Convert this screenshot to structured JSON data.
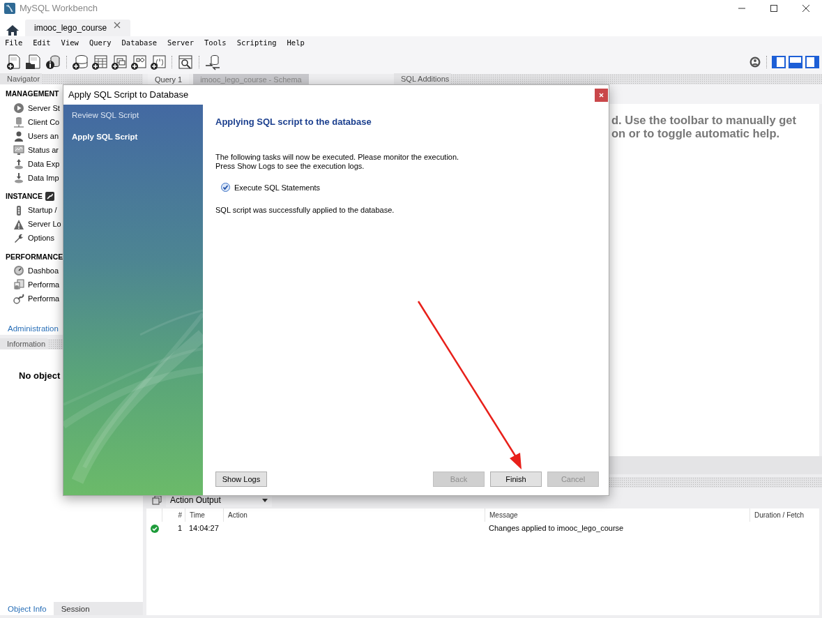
{
  "window": {
    "title": "MySQL Workbench"
  },
  "connection_tabs": [
    {
      "label": "imooc_lego_course",
      "selected": true
    }
  ],
  "menu": [
    "File",
    "Edit",
    "View",
    "Query",
    "Database",
    "Server",
    "Tools",
    "Scripting",
    "Help"
  ],
  "layout_toggles": [
    {
      "on": true
    },
    {
      "on": true
    },
    {
      "on": true
    }
  ],
  "navigator": {
    "title": "Navigator",
    "sections": [
      {
        "title": "MANAGEMENT",
        "items": [
          "Server St",
          "Client Co",
          "Users an",
          "Status ar",
          "Data Exp",
          "Data Imp"
        ]
      },
      {
        "title": "INSTANCE",
        "items": [
          "Startup /",
          "Server Lo",
          "Options"
        ]
      },
      {
        "title": "PERFORMANCE",
        "items": [
          "Dashboa",
          "Performa",
          "Performa"
        ]
      }
    ],
    "tabs": [
      {
        "label": "Administration",
        "selected": true
      }
    ]
  },
  "information": {
    "title": "Information",
    "text": "No object",
    "tabs": [
      {
        "label": "Object Info",
        "selected": true
      },
      {
        "label": "Session",
        "selected": false
      }
    ]
  },
  "editor_tabs": [
    {
      "label": "Query 1",
      "selected": false
    },
    {
      "label": "imooc_lego_course - Schema",
      "selected": true
    }
  ],
  "sql_additions": {
    "title": "SQL Additions",
    "help_lines": [
      "d. Use the toolbar to manually get",
      "on or to toggle automatic help."
    ]
  },
  "output": {
    "selector": "Action Output",
    "columns": [
      "#",
      "Time",
      "Action",
      "Message",
      "Duration / Fetch"
    ],
    "rows": [
      {
        "succeeded": true,
        "number": "1",
        "time": "14:04:27",
        "message": "Changes applied to imooc_lego_course"
      }
    ]
  },
  "dialog": {
    "title": "Apply SQL Script to Database",
    "steps": [
      {
        "label": "Review SQL Script",
        "selected": false
      },
      {
        "label": "Apply SQL Script",
        "selected": true
      }
    ],
    "heading": "Applying SQL script to the database",
    "description": [
      "The following tasks will now be executed. Please monitor the execution.",
      "Press Show Logs to see the execution logs."
    ],
    "tasks": [
      {
        "label": "Execute SQL Statements",
        "checked": true
      }
    ],
    "result": "SQL script was successfully applied to the database.",
    "buttons": [
      {
        "label": "Show Logs",
        "disabled": false,
        "kind": "left"
      },
      {
        "label": "Back",
        "disabled": true,
        "kind": "right"
      },
      {
        "label": "Finish",
        "disabled": false,
        "kind": "right"
      },
      {
        "label": "Cancel",
        "disabled": true,
        "kind": "right"
      }
    ]
  }
}
